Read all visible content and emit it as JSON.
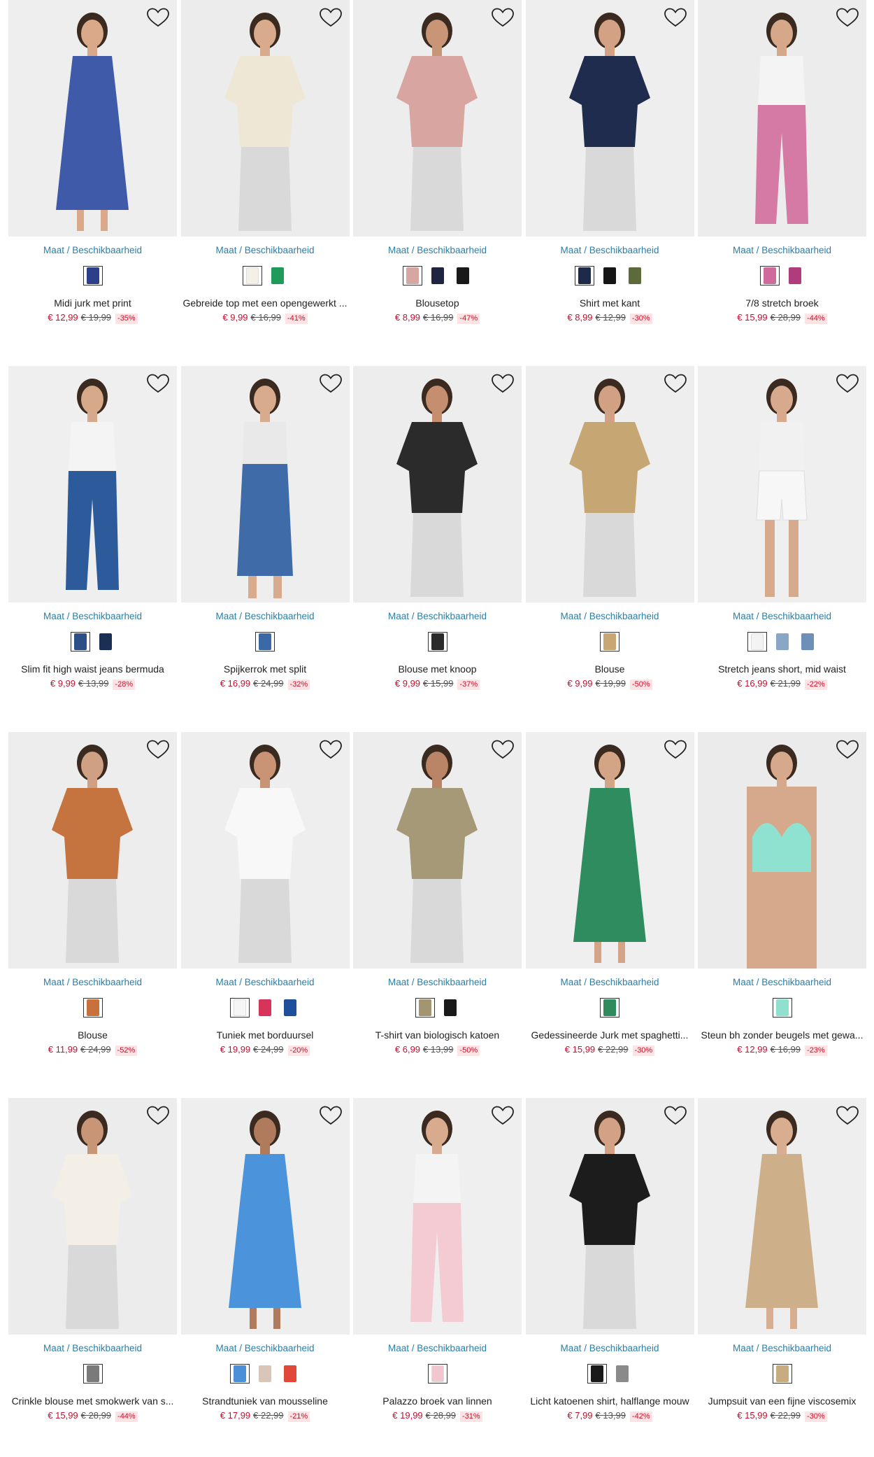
{
  "size_label": "Maat / Beschikbaarheid",
  "currency": "€",
  "colors": {
    "accent_link": "#2a7fa8",
    "price_red": "#c8102e",
    "discount_bg": "#fde3e3"
  },
  "products": [
    {
      "name": "Midi jurk met print",
      "price": "€ 12,99",
      "old": "€ 19,99",
      "disc": "-35%",
      "swatches": [
        "#2c3f8a"
      ],
      "img": {
        "bg": "#eeeeee",
        "garment": "#3f5aa8",
        "skin": "#d9a98a",
        "style": "dress"
      }
    },
    {
      "name": "Gebreide top met een opengewerkt ...",
      "price": "€ 9,99",
      "old": "€ 16,99",
      "disc": "-41%",
      "swatches": [
        "#f4f0e6",
        "#1f9a5a"
      ],
      "img": {
        "bg": "#ececec",
        "garment": "#efe7d6",
        "skin": "#d9ab8c",
        "style": "top"
      }
    },
    {
      "name": "Blousetop",
      "price": "€ 8,99",
      "old": "€ 16,99",
      "disc": "-47%",
      "swatches": [
        "#d8a6a2",
        "#1f2540",
        "#1a1a1a"
      ],
      "img": {
        "bg": "#ededed",
        "garment": "#d9a5a0",
        "skin": "#c99577",
        "style": "top"
      }
    },
    {
      "name": "Shirt met kant",
      "price": "€ 8,99",
      "old": "€ 12,99",
      "disc": "-30%",
      "swatches": [
        "#1e2a4a",
        "#151515",
        "#5d6a3a"
      ],
      "img": {
        "bg": "#eeeeee",
        "garment": "#1f2c4d",
        "skin": "#d3a184",
        "style": "top"
      }
    },
    {
      "name": "7/8 stretch broek",
      "price": "€ 15,99",
      "old": "€ 28,99",
      "disc": "-44%",
      "swatches": [
        "#d06a9a",
        "#b03c7e"
      ],
      "img": {
        "bg": "#ececec",
        "garment": "#d47aa4",
        "skin": "#d7a78a",
        "style": "pants"
      }
    },
    {
      "name": "Slim fit high waist jeans bermuda",
      "price": "€ 9,99",
      "old": "€ 13,99",
      "disc": "-28%",
      "swatches": [
        "#2b4f86",
        "#1b2f55"
      ],
      "img": {
        "bg": "#efefef",
        "garment": "#2d5a9a",
        "skin": "#d7a98b",
        "style": "pants"
      }
    },
    {
      "name": "Spijkerrok met split",
      "price": "€ 16,99",
      "old": "€ 24,99",
      "disc": "-32%",
      "swatches": [
        "#3c69a6"
      ],
      "img": {
        "bg": "#eeeeee",
        "garment": "#3f6ba8",
        "skin": "#d8ab8e",
        "style": "skirt"
      }
    },
    {
      "name": "Blouse met knoop",
      "price": "€ 9,99",
      "old": "€ 15,99",
      "disc": "-37%",
      "swatches": [
        "#2a2a2a"
      ],
      "img": {
        "bg": "#ededed",
        "garment": "#2b2b2b",
        "skin": "#c58e6f",
        "style": "top"
      }
    },
    {
      "name": "Blouse",
      "price": "€ 9,99",
      "old": "€ 19,99",
      "disc": "-50%",
      "swatches": [
        "#c8a775"
      ],
      "img": {
        "bg": "#eeeeee",
        "garment": "#c6a774",
        "skin": "#d2a083",
        "style": "top"
      }
    },
    {
      "name": "Stretch jeans short, mid waist",
      "price": "€ 16,99",
      "old": "€ 21,99",
      "disc": "-22%",
      "swatches": [
        "#f3f3f3",
        "#8aa6c6",
        "#6e8fb8"
      ],
      "img": {
        "bg": "#efefef",
        "garment": "#f7f7f7",
        "skin": "#d8aa8d",
        "style": "shorts"
      }
    },
    {
      "name": "Blouse",
      "price": "€ 11,99",
      "old": "€ 24,99",
      "disc": "-52%",
      "swatches": [
        "#c8713c"
      ],
      "img": {
        "bg": "#ededed",
        "garment": "#c6743f",
        "skin": "#d0a084",
        "style": "top"
      }
    },
    {
      "name": "Tuniek met borduursel",
      "price": "€ 19,99",
      "old": "€ 24,99",
      "disc": "-20%",
      "swatches": [
        "#f6f6f6",
        "#d8345a",
        "#1f4f9a"
      ],
      "img": {
        "bg": "#eeeeee",
        "garment": "#f8f8f8",
        "skin": "#c99476",
        "style": "top"
      }
    },
    {
      "name": "T-shirt van biologisch katoen",
      "price": "€ 6,99",
      "old": "€ 13,99",
      "disc": "-50%",
      "swatches": [
        "#a39572",
        "#1a1a1a"
      ],
      "img": {
        "bg": "#ededed",
        "garment": "#a69978",
        "skin": "#b98566",
        "style": "top"
      }
    },
    {
      "name": "Gedessineerde Jurk met spaghetti...",
      "price": "€ 15,99",
      "old": "€ 22,99",
      "disc": "-30%",
      "swatches": [
        "#2f8a5e"
      ],
      "img": {
        "bg": "#efefef",
        "garment": "#2e8c5f",
        "skin": "#d4a487",
        "style": "dress"
      }
    },
    {
      "name": "Steun bh zonder beugels met gewa...",
      "price": "€ 12,99",
      "old": "€ 16,99",
      "disc": "-23%",
      "swatches": [
        "#8fe0cf"
      ],
      "img": {
        "bg": "#ebebeb",
        "garment": "#8fe2d0",
        "skin": "#d6a98c",
        "style": "bra"
      }
    },
    {
      "name": "Crinkle blouse met smokwerk van s...",
      "price": "€ 15,99",
      "old": "€ 28,99",
      "disc": "-44%",
      "swatches": [
        "#7a7a7a"
      ],
      "img": {
        "bg": "#ececec",
        "garment": "#f3efe6",
        "skin": "#c99577",
        "style": "top"
      }
    },
    {
      "name": "Strandtuniek van mousseline",
      "price": "€ 17,99",
      "old": "€ 22,99",
      "disc": "-21%",
      "swatches": [
        "#4a8fd8",
        "#d9c6b8",
        "#e0483a"
      ],
      "img": {
        "bg": "#eeeeee",
        "garment": "#4b93da",
        "skin": "#b07a5c",
        "style": "dress"
      }
    },
    {
      "name": "Palazzo broek van linnen",
      "price": "€ 19,99",
      "old": "€ 28,99",
      "disc": "-31%",
      "swatches": [
        "#f2c6cf"
      ],
      "img": {
        "bg": "#efefef",
        "garment": "#f4cad3",
        "skin": "#d8ab8e",
        "style": "pants"
      }
    },
    {
      "name": "Licht katoenen shirt, halflange mouw",
      "price": "€ 7,99",
      "old": "€ 13,99",
      "disc": "-42%",
      "swatches": [
        "#1a1a1a",
        "#8a8a8a"
      ],
      "img": {
        "bg": "#ededed",
        "garment": "#1c1c1c",
        "skin": "#d3a184",
        "style": "top"
      }
    },
    {
      "name": "Jumpsuit van een fijne viscosemix",
      "price": "€ 15,99",
      "old": "€ 22,99",
      "disc": "-30%",
      "swatches": [
        "#c9ab80"
      ],
      "img": {
        "bg": "#eeeeee",
        "garment": "#cdb08a",
        "skin": "#d8ad90",
        "style": "dress"
      }
    }
  ]
}
